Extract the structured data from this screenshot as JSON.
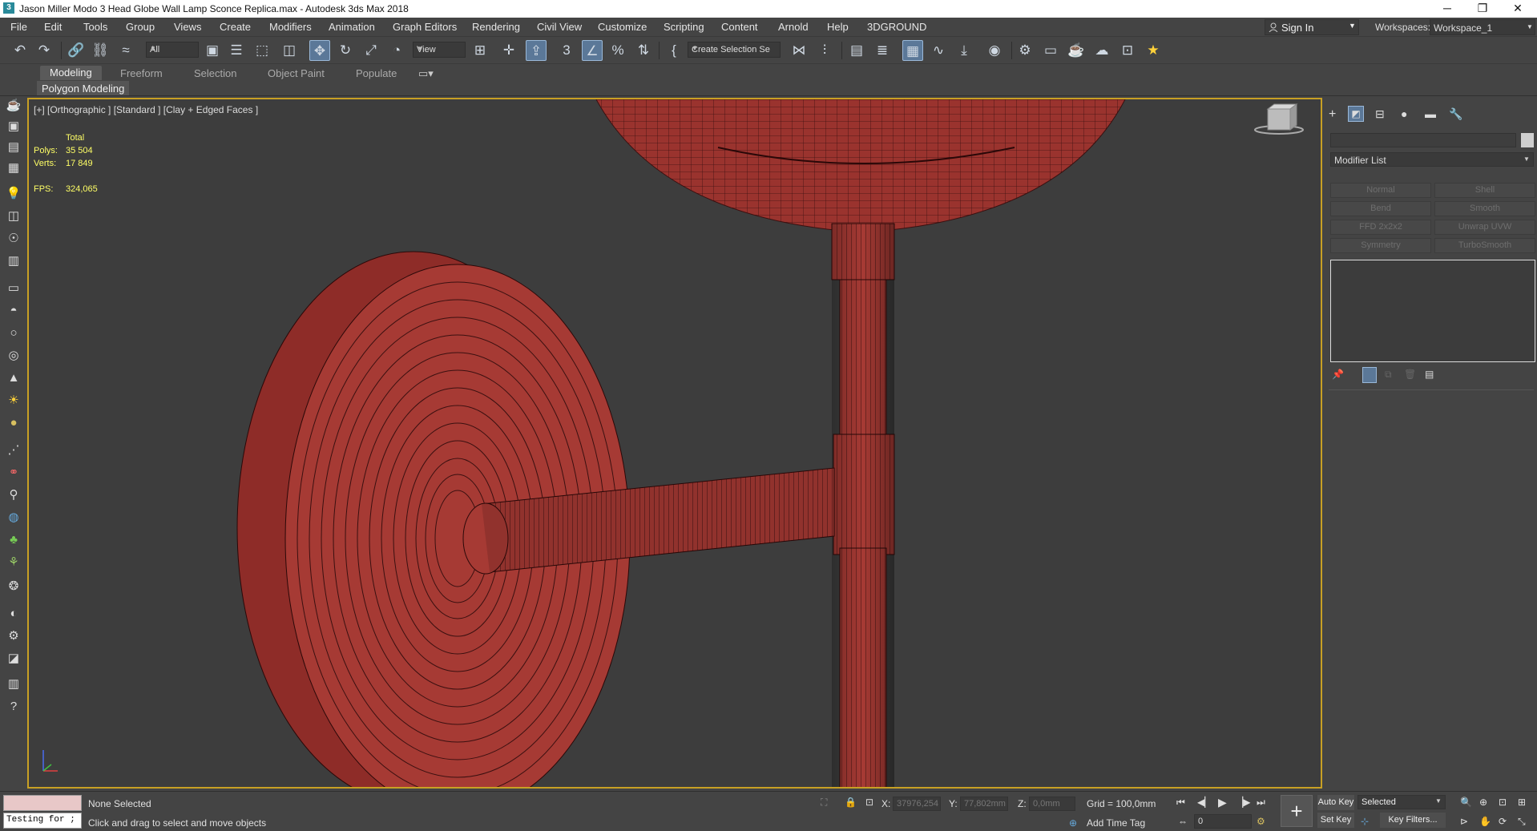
{
  "app": {
    "title": "Jason Miller Modo 3 Head Globe Wall Lamp Sconce Replica.max - Autodesk 3ds Max 2018",
    "minimize": "─",
    "restore": "❐",
    "close": "✕"
  },
  "menu": {
    "items": [
      "File",
      "Edit",
      "Tools",
      "Group",
      "Views",
      "Create",
      "Modifiers",
      "Animation",
      "Graph Editors",
      "Rendering",
      "Civil View",
      "Customize",
      "Scripting",
      "Content",
      "Arnold",
      "Help",
      "3DGROUND"
    ],
    "sign_in": "Sign In",
    "workspaces_label": "Workspaces:",
    "workspace_value": "Workspace_1"
  },
  "toolbar": {
    "filter_value": "All",
    "view_value": "View",
    "selection_set_value": "Create Selection Se"
  },
  "ribbon": {
    "tabs": [
      "Modeling",
      "Freeform",
      "Selection",
      "Object Paint",
      "Populate"
    ],
    "active_tab": "Modeling",
    "panel_label": "Polygon Modeling"
  },
  "viewport": {
    "label": "[+] [Orthographic ] [Standard ] [Clay + Edged Faces ]",
    "stats": {
      "total_label": "Total",
      "polys_label": "Polys:",
      "polys_value": "35 504",
      "verts_label": "Verts:",
      "verts_value": "17 849",
      "fps_label": "FPS:",
      "fps_value": "324,065"
    },
    "colors": {
      "mesh": "#a63a34",
      "wire": "#3a1010",
      "background": "#3d3d3d",
      "border": "#c8a024"
    }
  },
  "command_panel": {
    "modifier_list": "Modifier List",
    "buttons": [
      "Normal",
      "Shell",
      "Bend",
      "Smooth",
      "FFD 2x2x2",
      "Unwrap UVW",
      "Symmetry",
      "TurboSmooth"
    ]
  },
  "status": {
    "selection": "None Selected",
    "prompt": "Click and drag to select and move objects",
    "script_listener": "Testing for ;",
    "x_label": "X:",
    "x_value": "37976,254",
    "y_label": "Y:",
    "y_value": "77,802mm",
    "z_label": "Z:",
    "z_value": "0,0mm",
    "grid": "Grid = 100,0mm",
    "add_time_tag": "Add Time Tag",
    "auto_key": "Auto Key",
    "set_key": "Set Key",
    "key_mode_value": "Selected",
    "key_filters": "Key Filters...",
    "frame_value": "0"
  }
}
